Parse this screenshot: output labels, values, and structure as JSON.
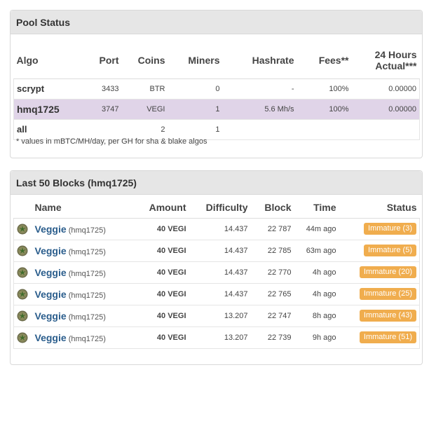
{
  "pool_status": {
    "title": "Pool Status",
    "headers": {
      "algo": "Algo",
      "port": "Port",
      "coins": "Coins",
      "miners": "Miners",
      "hashrate": "Hashrate",
      "fees": "Fees**",
      "actual_line1": "24 Hours",
      "actual_line2": "Actual***"
    },
    "rows": [
      {
        "algo": "scrypt",
        "port": "3433",
        "coins": "BTR",
        "miners": "0",
        "hashrate": "-",
        "fees": "100%",
        "actual": "0.00000"
      },
      {
        "algo": "hmq1725",
        "port": "3747",
        "coins": "VEGI",
        "miners": "1",
        "hashrate": "5.6 Mh/s",
        "fees": "100%",
        "actual": "0.00000"
      }
    ],
    "total": {
      "algo": "all",
      "coins": "2",
      "miners": "1"
    },
    "footnote": "* values in mBTC/MH/day, per GH for sha & blake algos"
  },
  "blocks": {
    "title": "Last 50 Blocks (hmq1725)",
    "headers": {
      "name": "Name",
      "amount": "Amount",
      "difficulty": "Difficulty",
      "block": "Block",
      "time": "Time",
      "status": "Status"
    },
    "rows": [
      {
        "name": "Veggie",
        "algo": "(hmq1725)",
        "amount": "40 VEGI",
        "difficulty": "14.437",
        "block": "22 787",
        "time": "44m ago",
        "status": "Immature (3)"
      },
      {
        "name": "Veggie",
        "algo": "(hmq1725)",
        "amount": "40 VEGI",
        "difficulty": "14.437",
        "block": "22 785",
        "time": "63m ago",
        "status": "Immature (5)"
      },
      {
        "name": "Veggie",
        "algo": "(hmq1725)",
        "amount": "40 VEGI",
        "difficulty": "14.437",
        "block": "22 770",
        "time": "4h ago",
        "status": "Immature (20)"
      },
      {
        "name": "Veggie",
        "algo": "(hmq1725)",
        "amount": "40 VEGI",
        "difficulty": "14.437",
        "block": "22 765",
        "time": "4h ago",
        "status": "Immature (25)"
      },
      {
        "name": "Veggie",
        "algo": "(hmq1725)",
        "amount": "40 VEGI",
        "difficulty": "13.207",
        "block": "22 747",
        "time": "8h ago",
        "status": "Immature (43)"
      },
      {
        "name": "Veggie",
        "algo": "(hmq1725)",
        "amount": "40 VEGI",
        "difficulty": "13.207",
        "block": "22 739",
        "time": "9h ago",
        "status": "Immature (51)"
      }
    ],
    "coin_icon": "veggie-coin-icon",
    "badge_color": "#f0ad4e"
  },
  "colors": {
    "selected_row": "#e0d4e8",
    "link": "#2a5d8c",
    "panel_header": "#e6e6e6"
  }
}
